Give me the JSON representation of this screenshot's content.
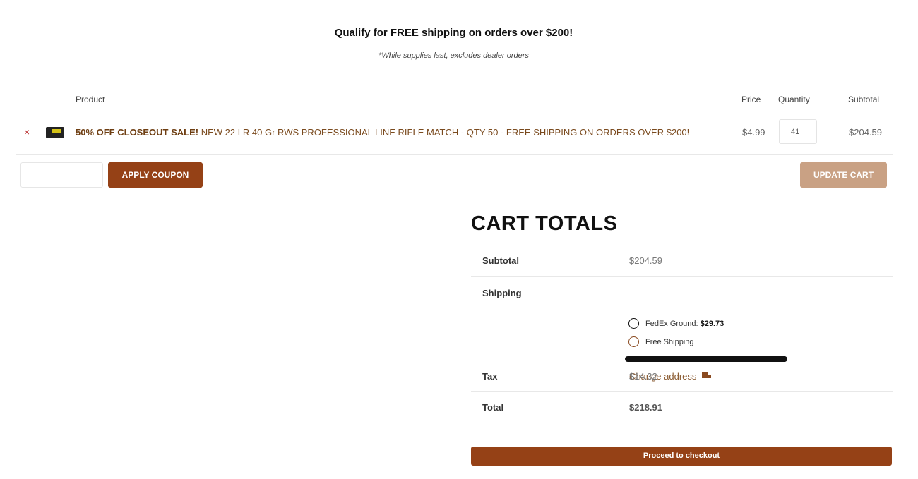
{
  "banner": {
    "title": "Qualify for FREE shipping on orders over $200!",
    "note": "*While supplies last, excludes dealer orders"
  },
  "cart": {
    "headers": {
      "product": "Product",
      "price": "Price",
      "quantity": "Quantity",
      "subtotal": "Subtotal"
    },
    "items": [
      {
        "remove": "×",
        "name_bold": "50% OFF CLOSEOUT SALE!",
        "name": " NEW 22 LR 40 Gr RWS PROFESSIONAL LINE RIFLE MATCH - QTY 50 - FREE SHIPPING ON ORDERS OVER $200!",
        "price": "$4.99",
        "quantity": "41",
        "subtotal": "$204.59"
      }
    ]
  },
  "coupon": {
    "placeholder": "",
    "apply_label": "APPLY COUPON"
  },
  "update_label": "UPDATE CART",
  "totals": {
    "title": "CART TOTALS",
    "subtotal_label": "Subtotal",
    "subtotal_value": "$204.59",
    "shipping_label": "Shipping",
    "options": [
      {
        "label": "FedEx Ground: ",
        "price": "$29.73"
      },
      {
        "label": "Free Shipping",
        "price": ""
      }
    ],
    "change_address": "Change address",
    "tax_label": "Tax",
    "tax_value": "$14.32",
    "total_label": "Total",
    "total_value": "$218.91"
  },
  "checkout_label": "Proceed to checkout",
  "colors": {
    "accent": "#954116",
    "accent_light": "#c9a184"
  },
  "icons": {
    "remove": "close-icon",
    "address": "truck-icon"
  }
}
